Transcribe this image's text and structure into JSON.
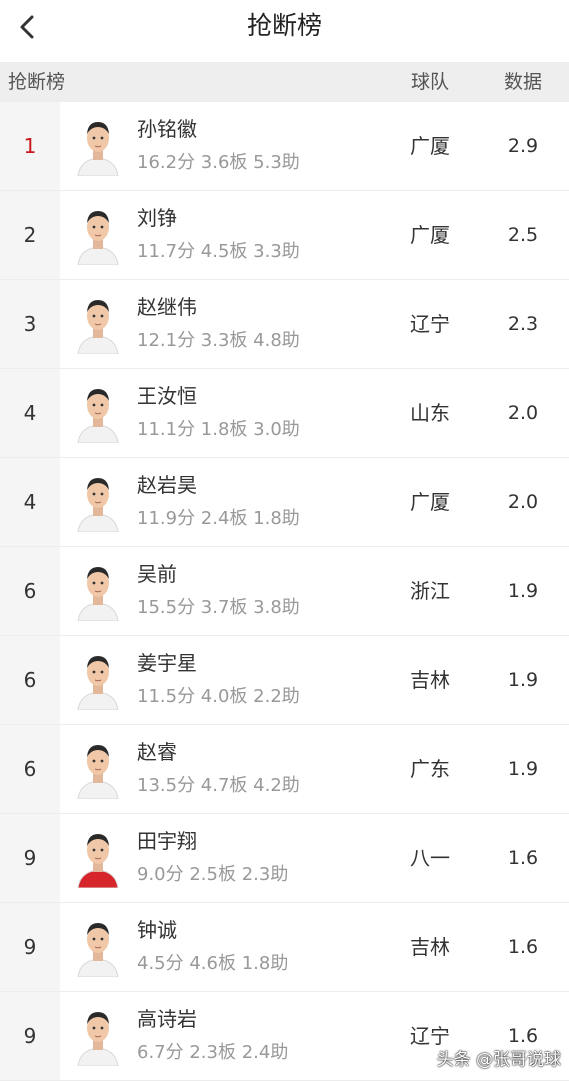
{
  "header": {
    "title": "抢断榜",
    "back_icon": "chevron-left-icon"
  },
  "table": {
    "columns": {
      "rank": "抢断榜",
      "team": "球队",
      "stat": "数据"
    },
    "active_row": 0,
    "accent_color": "#c8161d",
    "rows": [
      {
        "rank": "1",
        "name": "孙铭徽",
        "stats": "16.2分 3.6板 5.3助",
        "team": "广厦",
        "value": "2.9",
        "jersey": "#f2f2f2"
      },
      {
        "rank": "2",
        "name": "刘铮",
        "stats": "11.7分 4.5板 3.3助",
        "team": "广厦",
        "value": "2.5",
        "jersey": "#f2f2f2"
      },
      {
        "rank": "3",
        "name": "赵继伟",
        "stats": "12.1分 3.3板 4.8助",
        "team": "辽宁",
        "value": "2.3",
        "jersey": "#f2f2f2"
      },
      {
        "rank": "4",
        "name": "王汝恒",
        "stats": "11.1分 1.8板 3.0助",
        "team": "山东",
        "value": "2.0",
        "jersey": "#f2f2f2"
      },
      {
        "rank": "4",
        "name": "赵岩昊",
        "stats": "11.9分 2.4板 1.8助",
        "team": "广厦",
        "value": "2.0",
        "jersey": "#f2f2f2"
      },
      {
        "rank": "6",
        "name": "吴前",
        "stats": "15.5分 3.7板 3.8助",
        "team": "浙江",
        "value": "1.9",
        "jersey": "#f2f2f2"
      },
      {
        "rank": "6",
        "name": "姜宇星",
        "stats": "11.5分 4.0板 2.2助",
        "team": "吉林",
        "value": "1.9",
        "jersey": "#f2f2f2"
      },
      {
        "rank": "6",
        "name": "赵睿",
        "stats": "13.5分 4.7板 4.2助",
        "team": "广东",
        "value": "1.9",
        "jersey": "#f2f2f2"
      },
      {
        "rank": "9",
        "name": "田宇翔",
        "stats": "9.0分 2.5板 2.3助",
        "team": "八一",
        "value": "1.6",
        "jersey": "#d7262b"
      },
      {
        "rank": "9",
        "name": "钟诚",
        "stats": "4.5分 4.6板 1.8助",
        "team": "吉林",
        "value": "1.6",
        "jersey": "#f2f2f2"
      },
      {
        "rank": "9",
        "name": "高诗岩",
        "stats": "6.7分 2.3板 2.4助",
        "team": "辽宁",
        "value": "1.6",
        "jersey": "#f2f2f2"
      }
    ]
  },
  "watermark": "头条 @张哥说球"
}
